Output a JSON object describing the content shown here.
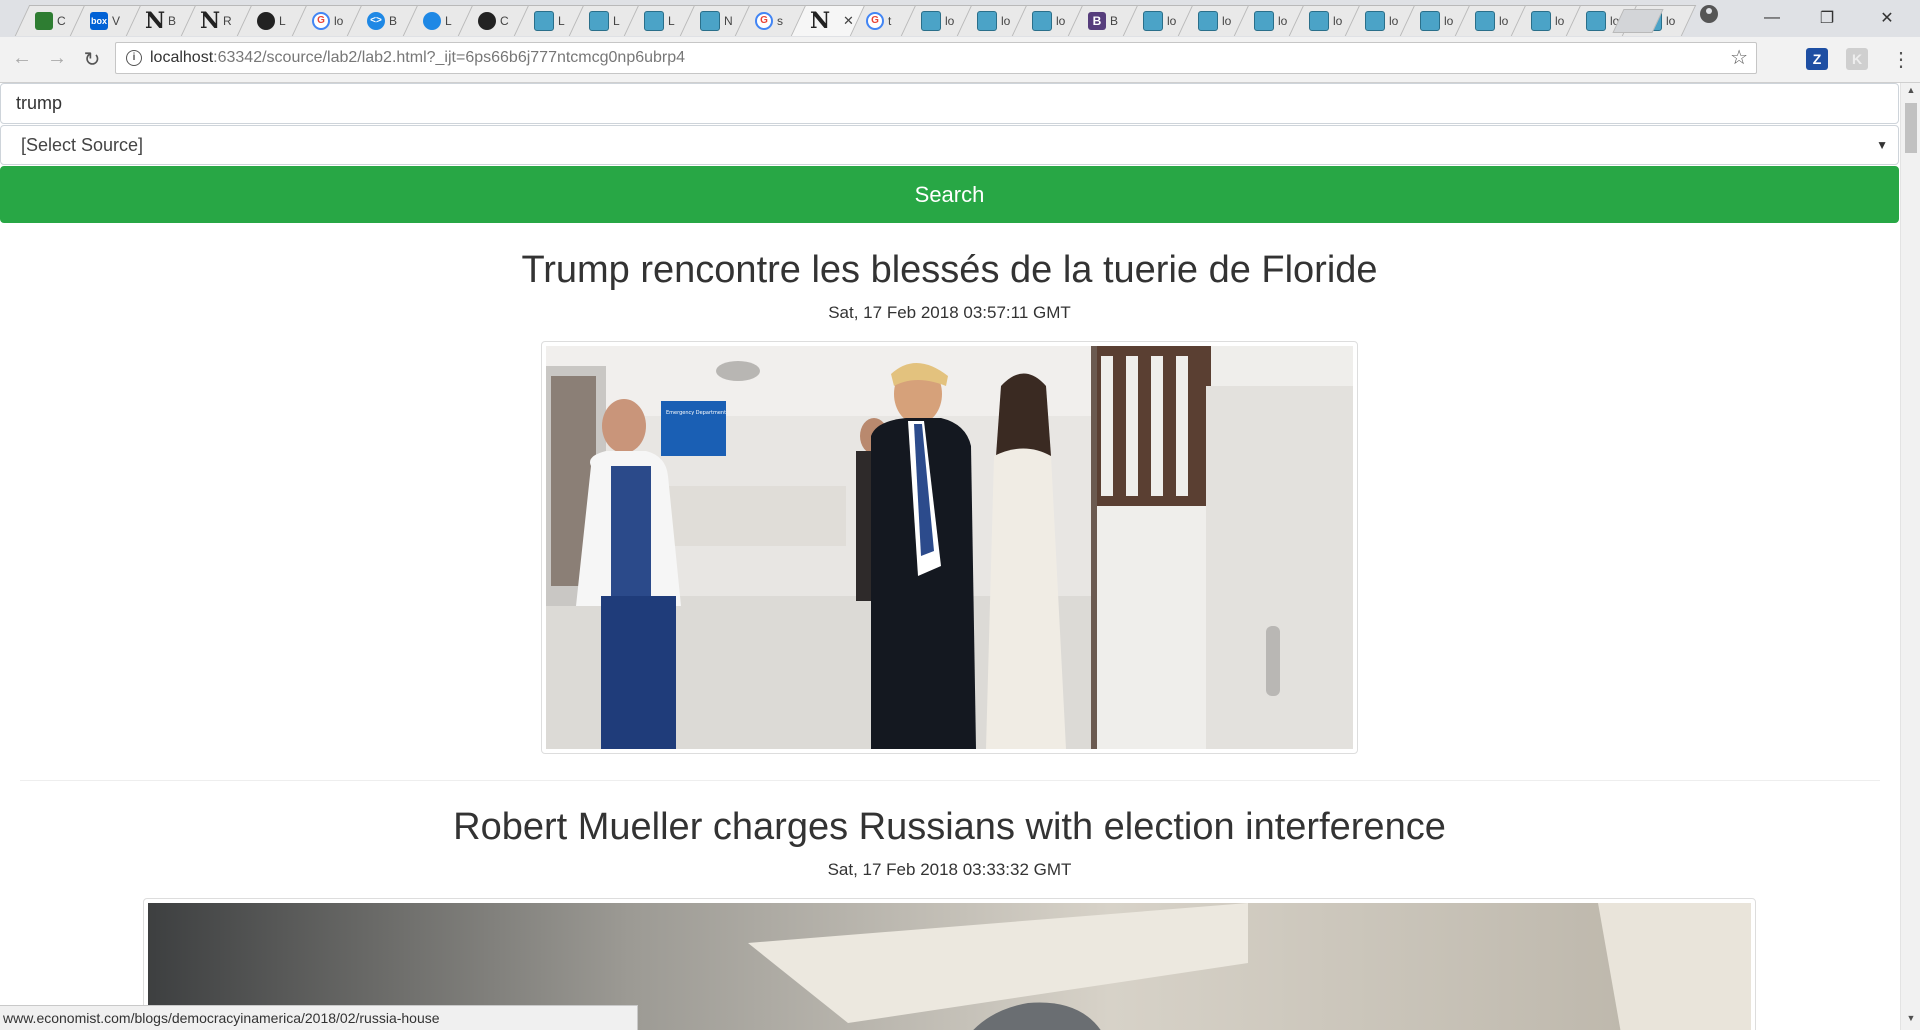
{
  "browser": {
    "tabs": [
      {
        "icon": "sheets-icon",
        "cls": "s",
        "glyph": "",
        "label": "C"
      },
      {
        "icon": "box-icon",
        "cls": "box",
        "glyph": "box",
        "label": "V"
      },
      {
        "icon": "n-icon",
        "cls": "n",
        "glyph": "N",
        "label": "B"
      },
      {
        "icon": "n-icon",
        "cls": "n",
        "glyph": "N",
        "label": "R"
      },
      {
        "icon": "github-icon",
        "cls": "gh",
        "glyph": "",
        "label": "L"
      },
      {
        "icon": "google-icon",
        "cls": "g",
        "glyph": "G",
        "label": "lo"
      },
      {
        "icon": "code-icon",
        "cls": "blue",
        "glyph": "<>",
        "label": "B"
      },
      {
        "icon": "drop-icon",
        "cls": "blue",
        "glyph": "",
        "label": "L"
      },
      {
        "icon": "github-icon",
        "cls": "gh",
        "glyph": "",
        "label": "C"
      },
      {
        "icon": "lab-icon",
        "cls": "lab",
        "glyph": "",
        "label": "L"
      },
      {
        "icon": "lab-icon",
        "cls": "lab",
        "glyph": "",
        "label": "L"
      },
      {
        "icon": "lab-icon",
        "cls": "lab",
        "glyph": "",
        "label": "L"
      },
      {
        "icon": "lab-icon",
        "cls": "lab",
        "glyph": "",
        "label": "N"
      },
      {
        "icon": "google-icon",
        "cls": "g",
        "glyph": "G",
        "label": "s"
      },
      {
        "icon": "n-icon",
        "cls": "n",
        "glyph": "N",
        "label": "",
        "active": true
      },
      {
        "icon": "google-icon",
        "cls": "g",
        "glyph": "G",
        "label": "t"
      },
      {
        "icon": "lab-icon",
        "cls": "lab",
        "glyph": "",
        "label": "lo"
      },
      {
        "icon": "lab-icon",
        "cls": "lab",
        "glyph": "",
        "label": "lo"
      },
      {
        "icon": "lab-icon",
        "cls": "lab",
        "glyph": "",
        "label": "lo"
      },
      {
        "icon": "bootstrap-icon",
        "cls": "bs",
        "glyph": "B",
        "label": "B"
      },
      {
        "icon": "lab-icon",
        "cls": "lab",
        "glyph": "",
        "label": "lo"
      },
      {
        "icon": "lab-icon",
        "cls": "lab",
        "glyph": "",
        "label": "lo"
      },
      {
        "icon": "lab-icon",
        "cls": "lab",
        "glyph": "",
        "label": "lo"
      },
      {
        "icon": "lab-icon",
        "cls": "lab",
        "glyph": "",
        "label": "lo"
      },
      {
        "icon": "lab-icon",
        "cls": "lab",
        "glyph": "",
        "label": "lo"
      },
      {
        "icon": "lab-icon",
        "cls": "lab",
        "glyph": "",
        "label": "lo"
      },
      {
        "icon": "lab-icon",
        "cls": "lab",
        "glyph": "",
        "label": "lo"
      },
      {
        "icon": "lab-icon",
        "cls": "lab",
        "glyph": "",
        "label": "lo"
      },
      {
        "icon": "lab-icon",
        "cls": "lab",
        "glyph": "",
        "label": "lo"
      },
      {
        "icon": "lab-icon",
        "cls": "lab",
        "glyph": "",
        "label": "lo"
      }
    ],
    "url_host": "localhost",
    "url_rest": ":63342/scource/lab2/lab2.html?_ijt=6ps66b6j777ntcmcg0np6ubrp4",
    "ext_z": "Z",
    "ext_k": "K"
  },
  "search": {
    "query": "trump",
    "source_selected": "[Select Source]",
    "button_label": "Search"
  },
  "articles": [
    {
      "title": "Trump rencontre les blessés de la tuerie de Floride",
      "date": "Sat, 17 Feb 2018 03:57:11 GMT"
    },
    {
      "title": "Robert Mueller charges Russians with election interference",
      "date": "Sat, 17 Feb 2018 03:33:32 GMT"
    }
  ],
  "photo1_sign": "Emergency Department",
  "status_url": "www.economist.com/blogs/democracyinamerica/2018/02/russia-house"
}
